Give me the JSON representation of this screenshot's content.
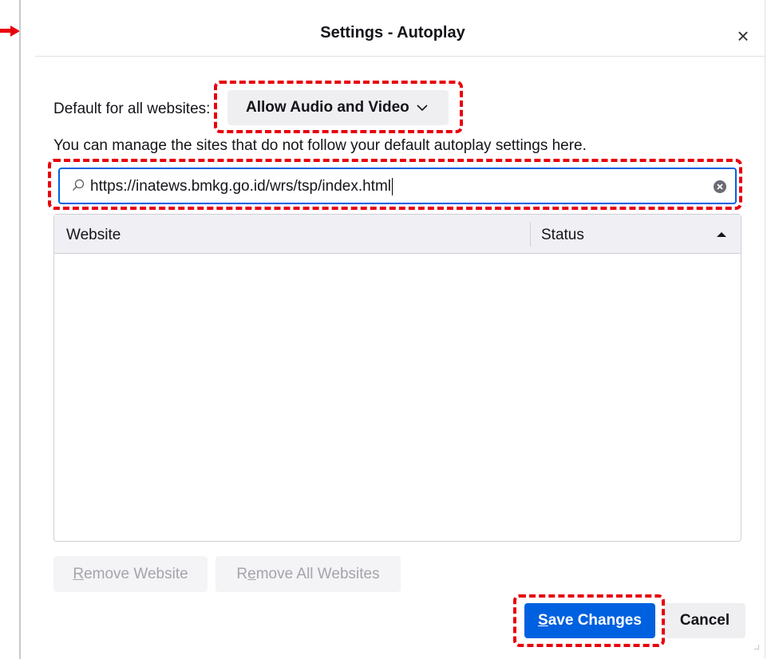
{
  "dialog": {
    "title": "Settings - Autoplay",
    "close_label": "×"
  },
  "default_setting": {
    "label": "Default for all websites:",
    "selected": "Allow Audio and Video"
  },
  "description": "You can manage the sites that do not follow your default autoplay settings here.",
  "search": {
    "value": "https://inatews.bmkg.go.id/wrs/tsp/index.html"
  },
  "table": {
    "columns": [
      "Website",
      "Status"
    ],
    "sort_column": "Status",
    "sort_direction": "ascending",
    "rows": []
  },
  "buttons": {
    "remove_website": {
      "mnemonic": "R",
      "rest": "emove Website",
      "enabled": false
    },
    "remove_all": {
      "pre": "R",
      "mnemonic": "e",
      "rest": "move All Websites",
      "enabled": false
    },
    "save": {
      "mnemonic": "S",
      "rest": "ave Changes"
    },
    "cancel": {
      "label": "Cancel"
    }
  },
  "colors": {
    "accent": "#0061e0",
    "annotation": "#e8000d"
  }
}
